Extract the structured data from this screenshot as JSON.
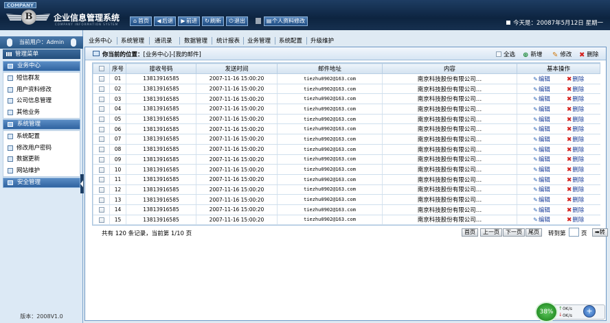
{
  "header": {
    "company_tag": "COMPANY",
    "logo_letter": "B",
    "title": "企业信息管理系统",
    "subtitle": "COMPANY INFORMATION SYSTEM",
    "buttons": {
      "home": "首页",
      "back": "后退",
      "forward": "前进",
      "refresh": "刷新",
      "logout": "退出",
      "profile": "个人资料修改"
    },
    "date_text": "今天是：20087年5月12日 星期一"
  },
  "sidebar": {
    "current_user": "当前用户：Admin",
    "menu_title": "管理菜单",
    "groups": [
      {
        "label": "业务中心",
        "items": [
          "短信群发",
          "用户资料修改",
          "公司信息管理",
          "其他业务"
        ]
      },
      {
        "label": "系统管理",
        "items": [
          "系统配置",
          "修改用户密码",
          "数据更新",
          "网站维护"
        ]
      },
      {
        "label": "安全管理",
        "items": []
      }
    ],
    "version": "版本：2008V1.0"
  },
  "nav": {
    "items": [
      "业务中心",
      "系统管理",
      "通讯录",
      "数据管理",
      "统计报表",
      "业务管理",
      "系统配置",
      "升级维护"
    ]
  },
  "panel": {
    "location_label": "你当前的位置：",
    "location_value": "[业务中心]-[我的邮件]",
    "tools": {
      "select_all": "全选",
      "add": "新增",
      "edit": "修改",
      "delete": "删除"
    }
  },
  "table": {
    "columns": [
      "",
      "序号",
      "接收号码",
      "发送时间",
      "邮件地址",
      "内容",
      "基本操作"
    ],
    "action_edit": "编辑",
    "action_delete": "删除",
    "rows": [
      {
        "no": "01",
        "phone": "13813916585",
        "time": "2007-11-16 15:00:20",
        "email": "tiezhu0902@163.com",
        "content": "南京科技股份有限公司…"
      },
      {
        "no": "02",
        "phone": "13813916585",
        "time": "2007-11-16 15:00:20",
        "email": "tiezhu0902@163.com",
        "content": "南京科技股份有限公司…"
      },
      {
        "no": "03",
        "phone": "13813916585",
        "time": "2007-11-16 15:00:20",
        "email": "tiezhu0902@163.com",
        "content": "南京科技股份有限公司…"
      },
      {
        "no": "04",
        "phone": "13813916585",
        "time": "2007-11-16 15:00:20",
        "email": "tiezhu0902@163.com",
        "content": "南京科技股份有限公司…"
      },
      {
        "no": "05",
        "phone": "13813916585",
        "time": "2007-11-16 15:00:20",
        "email": "tiezhu0902@163.com",
        "content": "南京科技股份有限公司…"
      },
      {
        "no": "06",
        "phone": "13813916585",
        "time": "2007-11-16 15:00:20",
        "email": "tiezhu0902@163.com",
        "content": "南京科技股份有限公司…"
      },
      {
        "no": "07",
        "phone": "13813916585",
        "time": "2007-11-16 15:00:20",
        "email": "tiezhu0902@163.com",
        "content": "南京科技股份有限公司…"
      },
      {
        "no": "08",
        "phone": "13813916585",
        "time": "2007-11-16 15:00:20",
        "email": "tiezhu0902@163.com",
        "content": "南京科技股份有限公司…"
      },
      {
        "no": "09",
        "phone": "13813916585",
        "time": "2007-11-16 15:00:20",
        "email": "tiezhu0902@163.com",
        "content": "南京科技股份有限公司…"
      },
      {
        "no": "10",
        "phone": "13813916585",
        "time": "2007-11-16 15:00:20",
        "email": "tiezhu0902@163.com",
        "content": "南京科技股份有限公司…"
      },
      {
        "no": "11",
        "phone": "13813916585",
        "time": "2007-11-16 15:00:20",
        "email": "tiezhu0902@163.com",
        "content": "南京科技股份有限公司…"
      },
      {
        "no": "12",
        "phone": "13813916585",
        "time": "2007-11-16 15:00:20",
        "email": "tiezhu0902@163.com",
        "content": "南京科技股份有限公司…"
      },
      {
        "no": "13",
        "phone": "13813916585",
        "time": "2007-11-16 15:00:20",
        "email": "tiezhu0902@163.com",
        "content": "南京科技股份有限公司…"
      },
      {
        "no": "14",
        "phone": "13813916585",
        "time": "2007-11-16 15:00:20",
        "email": "tiezhu0902@163.com",
        "content": "南京科技股份有限公司…"
      },
      {
        "no": "15",
        "phone": "13813916585",
        "time": "2007-11-16 15:00:20",
        "email": "tiezhu0902@163.com",
        "content": "南京科技股份有限公司…"
      }
    ]
  },
  "pager": {
    "info": "共有 120 条记录，当前第 1/10 页",
    "first": "首页",
    "prev": "上一页",
    "next": "下一页",
    "last": "尾页",
    "goto_label": "转到第",
    "page_unit": "页",
    "go": "转"
  },
  "net_monitor": {
    "percent": "38%",
    "up": "0K/s",
    "down": "0K/s"
  },
  "colors": {
    "header_bg": "#0d2440",
    "accent_blue": "#2f63a0",
    "delete_red": "#d4201d"
  }
}
